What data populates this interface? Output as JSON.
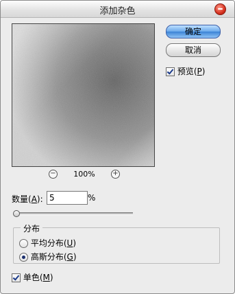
{
  "dialog": {
    "title": "添加杂色"
  },
  "buttons": {
    "ok": "确定",
    "cancel": "取消"
  },
  "preview_option": {
    "label": "预览",
    "mnemonic": "P",
    "checked": true
  },
  "zoom": {
    "level": "100%",
    "minus_icon": "zoom-out-icon",
    "plus_icon": "zoom-in-icon"
  },
  "amount": {
    "label": "数量",
    "mnemonic": "A",
    "colon": ":",
    "value": "5",
    "unit": "%",
    "slider_fraction": 0.01
  },
  "distribution": {
    "title": "分布",
    "options": [
      {
        "label": "平均分布",
        "mnemonic": "U",
        "selected": false
      },
      {
        "label": "高斯分布",
        "mnemonic": "G",
        "selected": true
      }
    ]
  },
  "monochrome": {
    "label": "单色",
    "mnemonic": "M",
    "checked": true
  }
}
